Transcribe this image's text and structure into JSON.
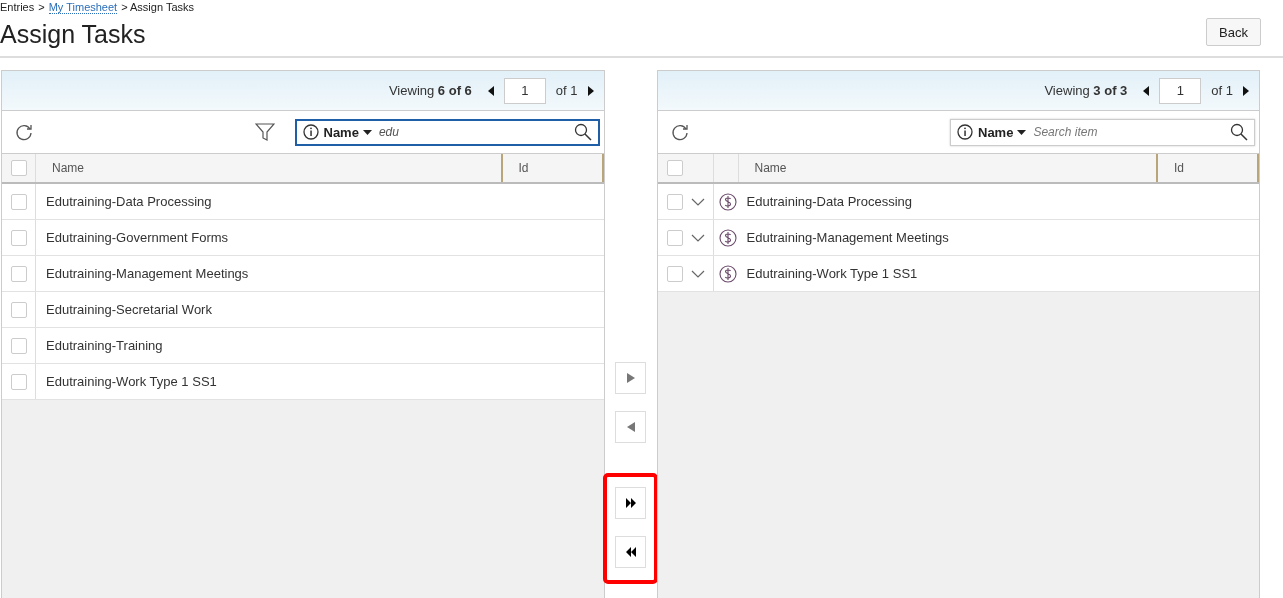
{
  "breadcrumb": [
    {
      "label": "Entries",
      "link": false
    },
    {
      "label": ">",
      "link": false
    },
    {
      "label": "My Timesheet",
      "link": true
    },
    {
      "label": "> Assign Tasks",
      "link": false
    }
  ],
  "title": "Assign Tasks",
  "back_button": "Back",
  "panels": [
    {
      "viewing": "Viewing **6 of 6**",
      "page": "1",
      "page_of": "of 1",
      "filter": true,
      "search": {
        "field": "Name",
        "value": "edu",
        "focused": true
      },
      "all_checked": false,
      "expandable": false,
      "columns": [
        "Name",
        "Id"
      ],
      "rows": [
        {
          "name": "Edutraining-Data Processing",
          "checked": false
        },
        {
          "name": "Edutraining-Government Forms",
          "checked": false
        },
        {
          "name": "Edutraining-Management Meetings",
          "checked": false
        },
        {
          "name": "Edutraining-Secretarial Work",
          "checked": false
        },
        {
          "name": "Edutraining-Training",
          "checked": false
        },
        {
          "name": "Edutraining-Work Type 1 SS1",
          "checked": false
        }
      ]
    },
    {
      "viewing": "Viewing **3 of 3**",
      "page": "1",
      "page_of": "of 1",
      "filter": false,
      "search": {
        "field": "Name",
        "placeholder": "Search item",
        "focused": false
      },
      "all_checked": false,
      "expandable": true,
      "columns": [
        "Name",
        "Id"
      ],
      "rows": [
        {
          "name": "Edutraining-Data Processing",
          "checked": false
        },
        {
          "name": "Edutraining-Management Meetings",
          "checked": false
        },
        {
          "name": "Edutraining-Work Type 1 SS1",
          "checked": false
        }
      ]
    }
  ],
  "transfer_groups": [
    {
      "highlighted": false,
      "buttons": [
        {
          "kind": "move-right",
          "disabled": true
        },
        {
          "kind": "move-left",
          "disabled": true
        }
      ]
    },
    {
      "highlighted": true,
      "buttons": [
        {
          "kind": "move-all-right",
          "disabled": false
        },
        {
          "kind": "move-all-left",
          "disabled": false
        }
      ]
    }
  ]
}
